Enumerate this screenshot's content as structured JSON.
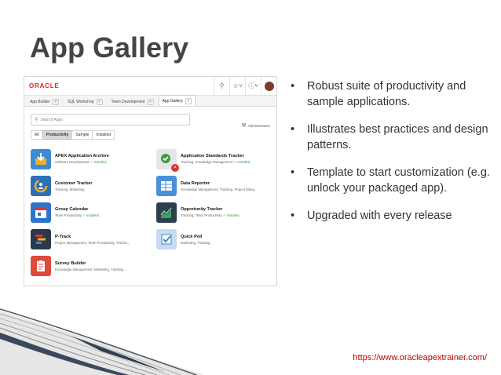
{
  "slide": {
    "title": "App Gallery",
    "bullets": [
      "Robust suite of productivity and sample applications.",
      "Illustrates best practices and design patterns.",
      "Template to start customization (e.g. unlock your packaged app).",
      "Upgraded with every release"
    ],
    "url": "https://www.oracleapextrainer.com/"
  },
  "app": {
    "logo": "ORACLE",
    "tabs": [
      "App Builder",
      "SQL Workshop",
      "Team Development",
      "App Gallery"
    ],
    "active_tab": "App Gallery",
    "search_placeholder": "Search Apps",
    "admin_label": "Administration",
    "filters": [
      "All",
      "Productivity",
      "Sample",
      "Installed"
    ],
    "active_filter": "Productivity",
    "installed_label": "Installed",
    "apps": [
      {
        "name": "APEX Application Archive",
        "meta": "Software Development",
        "installed": true,
        "icon": "archive-download-icon",
        "color": "#3d8bd4"
      },
      {
        "name": "Application Standards Tracker",
        "meta": "Tracking, Knowledge Management",
        "installed": true,
        "icon": "check-x-icon",
        "color": "#e6e6e6"
      },
      {
        "name": "Customer Tracker",
        "meta": "Tracking, Marketing",
        "installed": false,
        "icon": "person-chart-icon",
        "color": "#2f6fb7"
      },
      {
        "name": "Data Reporter",
        "meta": "Knowledge Management, Tracking, Project Mana...",
        "installed": false,
        "icon": "report-table-icon",
        "color": "#4a90d9"
      },
      {
        "name": "Group Calendar",
        "meta": "Team Productivity",
        "installed": true,
        "icon": "calendar-icon",
        "color": "#2e75c9"
      },
      {
        "name": "Opportunity Tracker",
        "meta": "Tracking, Team Productivity",
        "installed": true,
        "icon": "trend-chart-icon",
        "color": "#2c3e50"
      },
      {
        "name": "P-Track",
        "meta": "Project Management, Team Productivity, Trackin...",
        "installed": false,
        "icon": "gantt-icon",
        "color": "#2b3a4a"
      },
      {
        "name": "Quick Poll",
        "meta": "Marketing, Tracking",
        "installed": false,
        "icon": "checkmark-icon",
        "color": "#c9d9ee"
      },
      {
        "name": "Survey Builder",
        "meta": "Knowledge Management, Marketing, Tracking ...",
        "installed": false,
        "icon": "clipboard-icon",
        "color": "#e04a3c"
      }
    ]
  }
}
